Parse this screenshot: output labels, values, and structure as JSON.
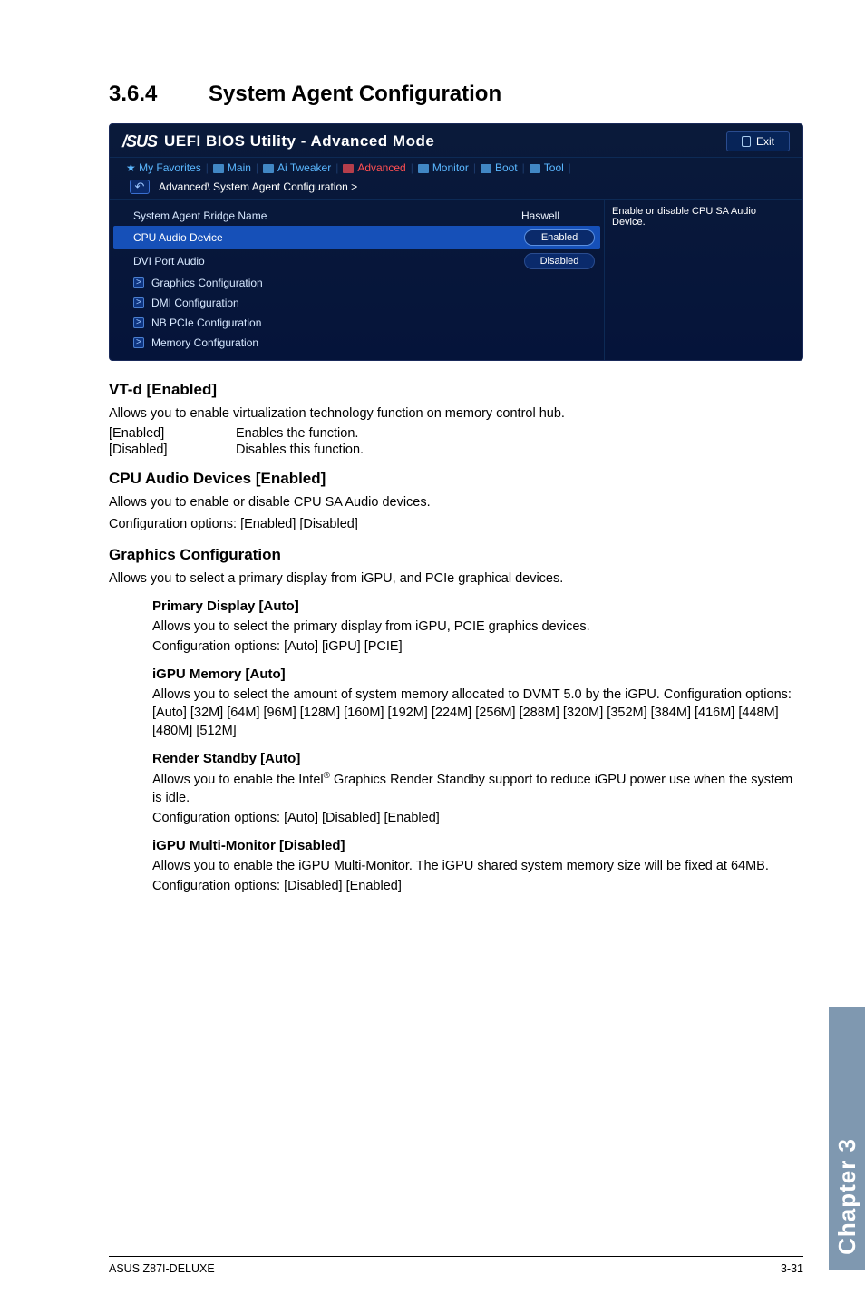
{
  "heading": {
    "number": "3.6.4",
    "title": "System Agent Configuration"
  },
  "bios": {
    "title": "UEFI BIOS Utility - Advanced Mode",
    "exit": "Exit",
    "tabs": {
      "fav": "My Favorites",
      "main": "Main",
      "ai": "Ai Tweaker",
      "adv": "Advanced",
      "mon": "Monitor",
      "boot": "Boot",
      "tool": "Tool"
    },
    "breadcrumb": "Advanced\\ System Agent Configuration >",
    "help": "Enable or disable CPU SA Audio Device.",
    "rows": {
      "r0": {
        "l": "System Agent Bridge Name",
        "v": "Haswell"
      },
      "r1": {
        "l": "CPU Audio Device",
        "v": "Enabled"
      },
      "r2": {
        "l": "DVI Port Audio",
        "v": "Disabled"
      },
      "r3": {
        "l": "Graphics Configuration"
      },
      "r4": {
        "l": "DMI Configuration"
      },
      "r5": {
        "l": "NB PCIe Configuration"
      },
      "r6": {
        "l": "Memory Configuration"
      }
    }
  },
  "s1": {
    "h": "VT-d [Enabled]",
    "p": "Allows you to enable virtualization technology function on memory control hub.",
    "d1k": "[Enabled]",
    "d1v": "Enables the function.",
    "d2k": "[Disabled]",
    "d2v": "Disables this function."
  },
  "s2": {
    "h": "CPU Audio Devices [Enabled]",
    "p1": "Allows you to enable or disable CPU SA Audio devices.",
    "p2": "Configuration options: [Enabled] [Disabled]"
  },
  "s3": {
    "h": "Graphics Configuration",
    "p": "Allows you to select a primary display from iGPU, and PCIe graphical devices.",
    "a": {
      "h": "Primary Display [Auto]",
      "p1": "Allows you to select the primary display from iGPU, PCIE graphics devices.",
      "p2": "Configuration options: [Auto] [iGPU] [PCIE]"
    },
    "b": {
      "h": "iGPU Memory [Auto]",
      "p": "Allows you to select the amount of system memory allocated to DVMT 5.0 by the iGPU. Configuration options: [Auto] [32M] [64M] [96M] [128M] [160M] [192M] [224M] [256M] [288M] [320M] [352M] [384M] [416M] [448M] [480M] [512M]"
    },
    "c": {
      "h": "Render Standby [Auto]",
      "p1a": "Allows you to enable the Intel",
      "p1b": " Graphics Render Standby support to reduce iGPU power use when the system is idle.",
      "p2": "Configuration options: [Auto] [Disabled] [Enabled]"
    },
    "d": {
      "h": "iGPU Multi-Monitor [Disabled]",
      "p1": "Allows you to enable the iGPU Multi-Monitor. The iGPU shared system memory size will be fixed at 64MB.",
      "p2": "Configuration options: [Disabled] [Enabled]"
    }
  },
  "sidebar": "Chapter 3",
  "footer": {
    "l": "ASUS Z87I-DELUXE",
    "r": "3-31"
  }
}
